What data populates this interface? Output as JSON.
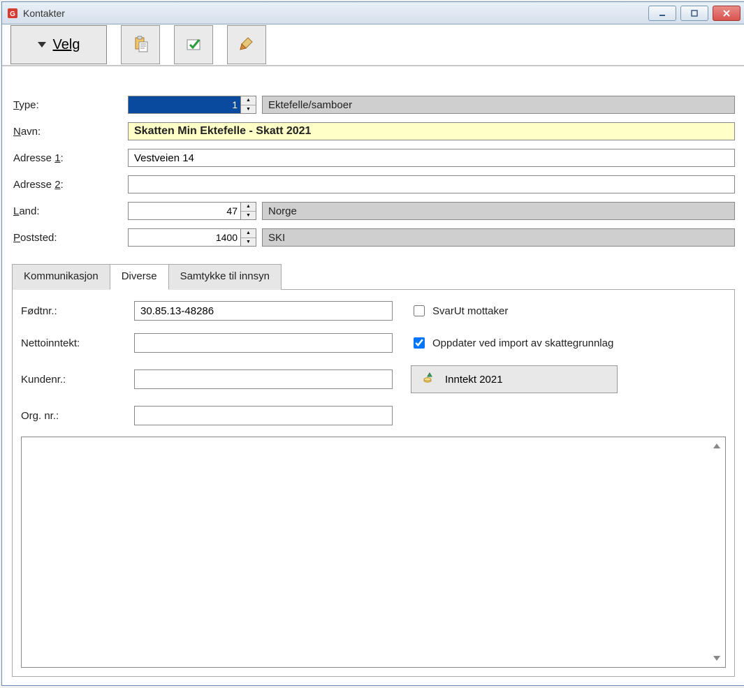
{
  "window": {
    "title": "Kontakter"
  },
  "toolbar": {
    "velg_label": "Velg"
  },
  "form": {
    "type_label": "Type:",
    "type_value": "1",
    "type_desc": "Ektefelle/samboer",
    "navn_label": "Navn:",
    "navn_value": "Skatten Min Ektefelle - Skatt 2021",
    "adresse1_label": "Adresse 1:",
    "adresse1_value": "Vestveien 14",
    "adresse2_label": "Adresse 2:",
    "adresse2_value": "",
    "land_label": "Land:",
    "land_value": "47",
    "land_desc": "Norge",
    "poststed_label": "Poststed:",
    "poststed_value": "1400",
    "poststed_desc": "SKI"
  },
  "tabs": {
    "kommunikasjon": "Kommunikasjon",
    "diverse": "Diverse",
    "samtykke": "Samtykke til innsyn"
  },
  "diverse": {
    "fodtnr_label": "Fødtnr.:",
    "fodtnr_value": "30.85.13-48286",
    "nettoinntekt_label": "Nettoinntekt:",
    "nettoinntekt_value": "",
    "kundenr_label": "Kundenr.:",
    "kundenr_value": "",
    "orgnr_label": "Org. nr.:",
    "orgnr_value": "",
    "svarut_label": "SvarUt mottaker",
    "svarut_checked": false,
    "oppdater_label": "Oppdater ved import av skattegrunnlag",
    "oppdater_checked": true,
    "inntekt_label": "Inntekt 2021",
    "notes": ""
  }
}
